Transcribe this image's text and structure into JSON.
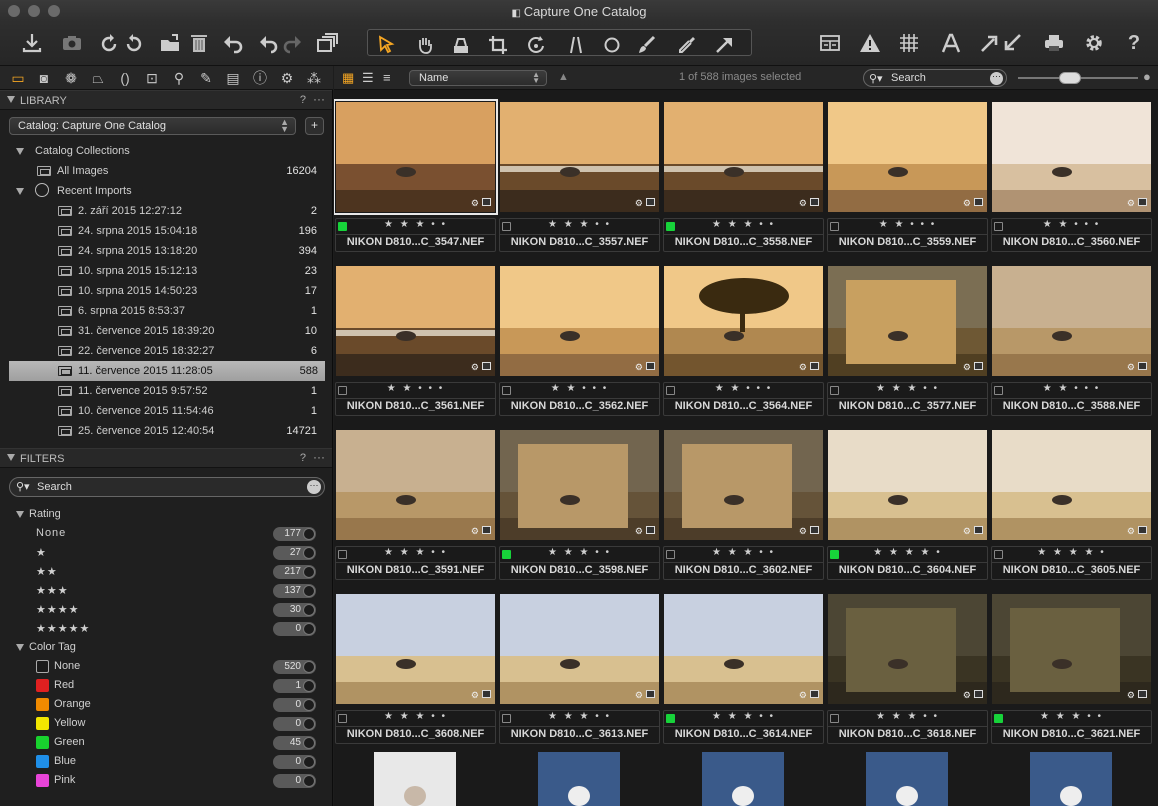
{
  "window": {
    "title": "Capture One Catalog"
  },
  "toolbar": {
    "left_icons": [
      "import-icon",
      "camera-icon",
      "rotate-left-icon",
      "rotate-right-icon",
      "move-to-folder-icon",
      "trash-icon",
      "undo-icon",
      "redo-left-icon",
      "redo-right-icon",
      "variants-icon"
    ],
    "cursor_tools": [
      "select-cursor-icon",
      "pan-icon",
      "crop-overlay-icon",
      "crop-icon",
      "rotate-tool-icon",
      "keystone-icon",
      "circle-mask-icon",
      "brush-icon",
      "eyedropper-icon",
      "arrow-tool-icon"
    ],
    "right_icons": [
      "compare-icon",
      "warning-icon",
      "grid-icon",
      "text-icon",
      "expand-icon",
      "print-icon",
      "settings-icon",
      "help-icon"
    ]
  },
  "tool_tabs": [
    "library-tab",
    "capture-tab",
    "color-tab",
    "exposure-tab",
    "lens-tab",
    "crop-tab",
    "details-tab",
    "adjust-tab",
    "metadata-tab",
    "info-tab",
    "output-tab",
    "batch-tab"
  ],
  "library": {
    "header": "LIBRARY",
    "help": "?",
    "catalog_select": "Catalog: Capture One Catalog",
    "catalog_collections": "Catalog Collections",
    "all_images": {
      "label": "All Images",
      "count": "16204"
    },
    "recent_imports": "Recent Imports",
    "imports": [
      {
        "label": "2. září 2015 12:27:12",
        "count": "2"
      },
      {
        "label": "24. srpna 2015 15:04:18",
        "count": "196"
      },
      {
        "label": "24. srpna 2015 13:18:20",
        "count": "394"
      },
      {
        "label": "10. srpna 2015 15:12:13",
        "count": "23"
      },
      {
        "label": "10. srpna 2015 14:50:23",
        "count": "17"
      },
      {
        "label": "6. srpna 2015 8:53:37",
        "count": "1"
      },
      {
        "label": "31. července 2015 18:39:20",
        "count": "10"
      },
      {
        "label": "22. července 2015 18:32:27",
        "count": "6"
      },
      {
        "label": "11. července 2015 11:28:05",
        "count": "588",
        "selected": true
      },
      {
        "label": "11. července 2015 9:57:52",
        "count": "1"
      },
      {
        "label": "10. července 2015 11:54:46",
        "count": "1"
      },
      {
        "label": "25. července 2015 12:40:54",
        "count": "14721"
      }
    ]
  },
  "filters": {
    "header": "FILTERS",
    "help": "?",
    "search_placeholder": "Search",
    "rating_title": "Rating",
    "ratings": [
      {
        "label": "None",
        "count": "177"
      },
      {
        "label": "★",
        "count": "27"
      },
      {
        "label": "★★",
        "count": "217"
      },
      {
        "label": "★★★",
        "count": "137"
      },
      {
        "label": "★★★★",
        "count": "30"
      },
      {
        "label": "★★★★★",
        "count": "0"
      }
    ],
    "color_title": "Color Tag",
    "colors": [
      {
        "label": "None",
        "count": "520",
        "color": "#1a1a1a"
      },
      {
        "label": "Red",
        "count": "1",
        "color": "#e02020"
      },
      {
        "label": "Orange",
        "count": "0",
        "color": "#f08a00"
      },
      {
        "label": "Yellow",
        "count": "0",
        "color": "#f2e600"
      },
      {
        "label": "Green",
        "count": "45",
        "color": "#18d32e"
      },
      {
        "label": "Blue",
        "count": "0",
        "color": "#1f8fe8"
      },
      {
        "label": "Pink",
        "count": "0",
        "color": "#e844d8"
      }
    ]
  },
  "browser": {
    "sort": "Name",
    "selection": "1 of 588 images selected",
    "search_placeholder": "Search",
    "zoom_level": 0.42,
    "images": [
      {
        "name": "NIKON D810...C_3547.NEF",
        "stars": "★ ★ ★ • •",
        "tag": "green",
        "scene": "dusk",
        "active": true
      },
      {
        "name": "NIKON D810...C_3557.NEF",
        "stars": "★ ★ ★ • •",
        "tag": "none",
        "scene": "dusk-water"
      },
      {
        "name": "NIKON D810...C_3558.NEF",
        "stars": "★ ★ ★ • •",
        "tag": "green",
        "scene": "dusk-water"
      },
      {
        "name": "NIKON D810...C_3559.NEF",
        "stars": "★ ★ • • •",
        "tag": "none",
        "scene": "gold"
      },
      {
        "name": "NIKON D810...C_3560.NEF",
        "stars": "★ ★ • • •",
        "tag": "none",
        "scene": "pale"
      },
      {
        "name": "NIKON D810...C_3561.NEF",
        "stars": "★ ★ • • •",
        "tag": "none",
        "scene": "dusk-water"
      },
      {
        "name": "NIKON D810...C_3562.NEF",
        "stars": "★ ★ • • •",
        "tag": "none",
        "scene": "gold"
      },
      {
        "name": "NIKON D810...C_3564.NEF",
        "stars": "★ ★ • • •",
        "tag": "none",
        "scene": "tree"
      },
      {
        "name": "NIKON D810...C_3577.NEF",
        "stars": "★ ★ ★ • •",
        "tag": "none",
        "scene": "crop-savanna"
      },
      {
        "name": "NIKON D810...C_3588.NEF",
        "stars": "★ ★ • • •",
        "tag": "none",
        "scene": "grass"
      },
      {
        "name": "NIKON D810...C_3591.NEF",
        "stars": "★ ★ ★ • •",
        "tag": "none",
        "scene": "grass"
      },
      {
        "name": "NIKON D810...C_3598.NEF",
        "stars": "★ ★ ★ • •",
        "tag": "green",
        "scene": "crop-grass"
      },
      {
        "name": "NIKON D810...C_3602.NEF",
        "stars": "★ ★ ★ • •",
        "tag": "none",
        "scene": "crop-grass"
      },
      {
        "name": "NIKON D810...C_3604.NEF",
        "stars": "★ ★ ★ ★ •",
        "tag": "green",
        "scene": "savanna"
      },
      {
        "name": "NIKON D810...C_3605.NEF",
        "stars": "★ ★ ★ ★ •",
        "tag": "none",
        "scene": "savanna"
      },
      {
        "name": "NIKON D810...C_3608.NEF",
        "stars": "★ ★ ★ • •",
        "tag": "none",
        "scene": "savanna-sky"
      },
      {
        "name": "NIKON D810...C_3613.NEF",
        "stars": "★ ★ ★ • •",
        "tag": "none",
        "scene": "savanna-sky"
      },
      {
        "name": "NIKON D810...C_3614.NEF",
        "stars": "★ ★ ★ • •",
        "tag": "green",
        "scene": "savanna-sky"
      },
      {
        "name": "NIKON D810...C_3618.NEF",
        "stars": "★ ★ ★ • •",
        "tag": "none",
        "scene": "crop-ground"
      },
      {
        "name": "NIKON D810...C_3621.NEF",
        "stars": "★ ★ ★ • •",
        "tag": "green",
        "scene": "crop-ground"
      }
    ]
  }
}
